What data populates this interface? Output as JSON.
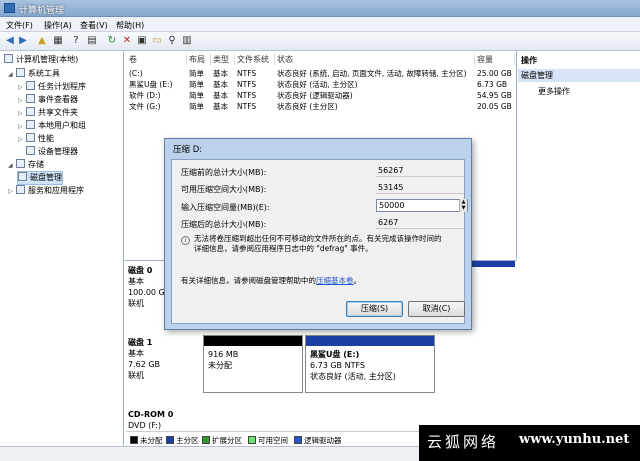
{
  "window": {
    "title": "计算机管理"
  },
  "menu": [
    "文件(F)",
    "操作(A)",
    "查看(V)",
    "帮助(H)"
  ],
  "tree": {
    "root": "计算机管理(本地)",
    "system_tools": "系统工具",
    "items": [
      "任务计划程序",
      "事件查看器",
      "共享文件夹",
      "本地用户和组",
      "性能",
      "设备管理器"
    ],
    "storage": "存储",
    "disk_mgmt": "磁盘管理",
    "services": "服务和应用程序"
  },
  "list": {
    "headers": [
      "卷",
      "布局",
      "类型",
      "文件系统",
      "状态",
      "容量"
    ],
    "rows": [
      {
        "vol": "(C:)",
        "layout": "简单",
        "type": "基本",
        "fs": "NTFS",
        "status": "状态良好 (系统, 启动, 页面文件, 活动, 故障转储, 主分区)",
        "cap": "25.00 GB"
      },
      {
        "vol": "黑鲨U盘 (E:)",
        "layout": "简单",
        "type": "基本",
        "fs": "NTFS",
        "status": "状态良好 (活动, 主分区)",
        "cap": "6.73 GB"
      },
      {
        "vol": "软件 (D:)",
        "layout": "简单",
        "type": "基本",
        "fs": "NTFS",
        "status": "状态良好 (逻辑驱动器)",
        "cap": "54.95 GB"
      },
      {
        "vol": "文件 (G:)",
        "layout": "简单",
        "type": "基本",
        "fs": "NTFS",
        "status": "状态良好 (主分区)",
        "cap": "20.05 GB"
      }
    ]
  },
  "actions": {
    "header": "操作",
    "selected": "磁盘管理",
    "more": "更多操作"
  },
  "disks": {
    "disk0": {
      "name": "磁盘 0",
      "type": "基本",
      "size": "100.00 GB",
      "state": "联机"
    },
    "disk1": {
      "name": "磁盘 1",
      "type": "基本",
      "size": "7.62 GB",
      "state": "联机"
    },
    "unalloc": {
      "size": "916 MB",
      "label": "未分配"
    },
    "usb": {
      "name": "黑鲨U盘 (E:)",
      "size": "6.73 GB NTFS",
      "status": "状态良好 (活动, 主分区)"
    },
    "cdrom": {
      "name": "CD-ROM 0",
      "label": "DVD (F:)"
    }
  },
  "legend": [
    {
      "label": "未分配",
      "color": "#000000"
    },
    {
      "label": "主分区",
      "color": "#1d3fa5"
    },
    {
      "label": "扩展分区",
      "color": "#2e9a2e"
    },
    {
      "label": "可用空间",
      "color": "#6fe26f"
    },
    {
      "label": "逻辑驱动器",
      "color": "#2b51c8"
    }
  ],
  "dialog": {
    "title": "压缩 D:",
    "total_before_label": "压缩前的总计大小(MB):",
    "total_before": "56267",
    "available_label": "可用压缩空间大小(MB):",
    "available": "53145",
    "input_label": "输入压缩空间量(MB)(E):",
    "input_value": "50000",
    "total_after_label": "压缩后的总计大小(MB):",
    "total_after": "6267",
    "note_line1": "无法将卷压缩到超出任何不可移动的文件所在的点。有关完成该操作时间的",
    "note_line2": "详细信息，请参阅应用程序日志中的 \"defrag\" 事件。",
    "help_prefix": "有关详细信息，请参阅磁盘管理帮助中的",
    "help_link": "压缩基本卷",
    "help_suffix": "。",
    "ok": "压缩(S)",
    "cancel": "取消(C)"
  },
  "watermark": {
    "cn": "云狐网络",
    "url": "www.yunhu.net"
  }
}
